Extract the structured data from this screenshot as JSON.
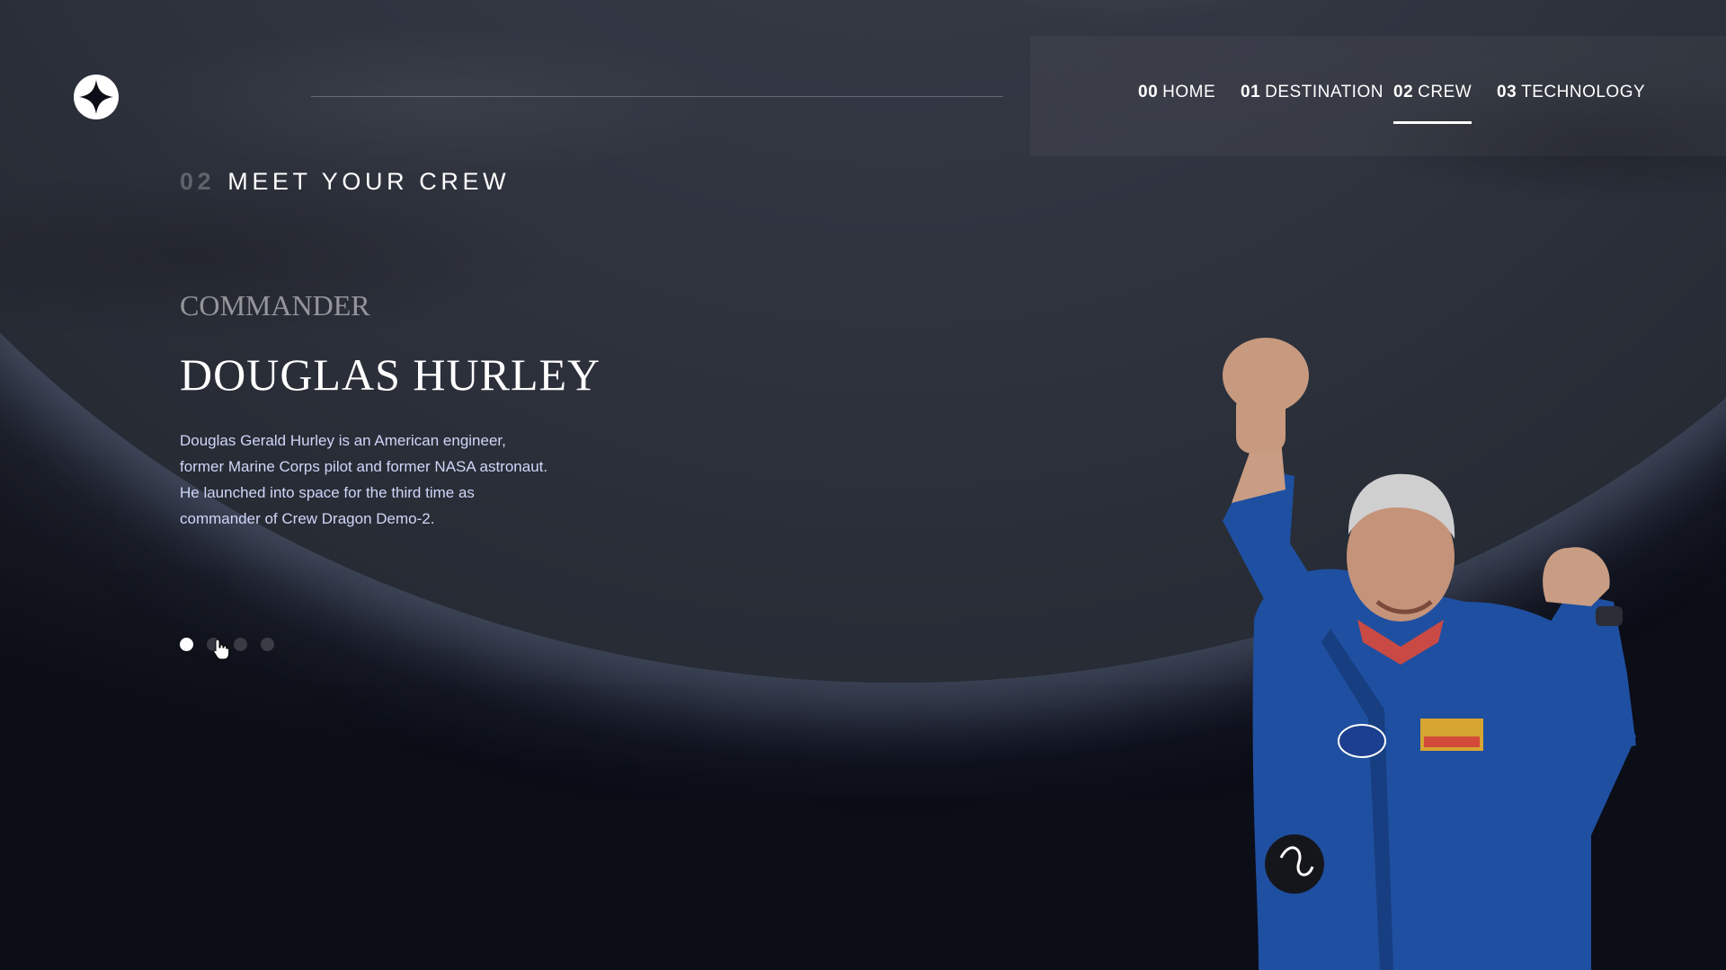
{
  "header": {
    "logo_icon": "star-logo-icon",
    "nav": [
      {
        "num": "00",
        "label": "HOME",
        "active": false
      },
      {
        "num": "01",
        "label": "DESTINATION",
        "active": false
      },
      {
        "num": "02",
        "label": "CREW",
        "active": true
      },
      {
        "num": "03",
        "label": "TECHNOLOGY",
        "active": false
      }
    ]
  },
  "main": {
    "eyebrow_num": "02",
    "eyebrow_title": "MEET YOUR CREW",
    "role": "COMMANDER",
    "name": "DOUGLAS HURLEY",
    "bio": "Douglas Gerald Hurley is an American engineer, former Marine Corps pilot and former NASA astronaut. He launched into space for the third time as commander of Crew Dragon Demo-2.",
    "crew_dots": [
      {
        "active": true
      },
      {
        "active": false
      },
      {
        "active": false
      },
      {
        "active": false
      }
    ],
    "image_subject": "astronaut-in-blue-flight-suit-with-raised-fists"
  },
  "colors": {
    "background": "#0b0d17",
    "accent_text": "#d0d6f9",
    "suit_blue": "#1f4fa0"
  }
}
